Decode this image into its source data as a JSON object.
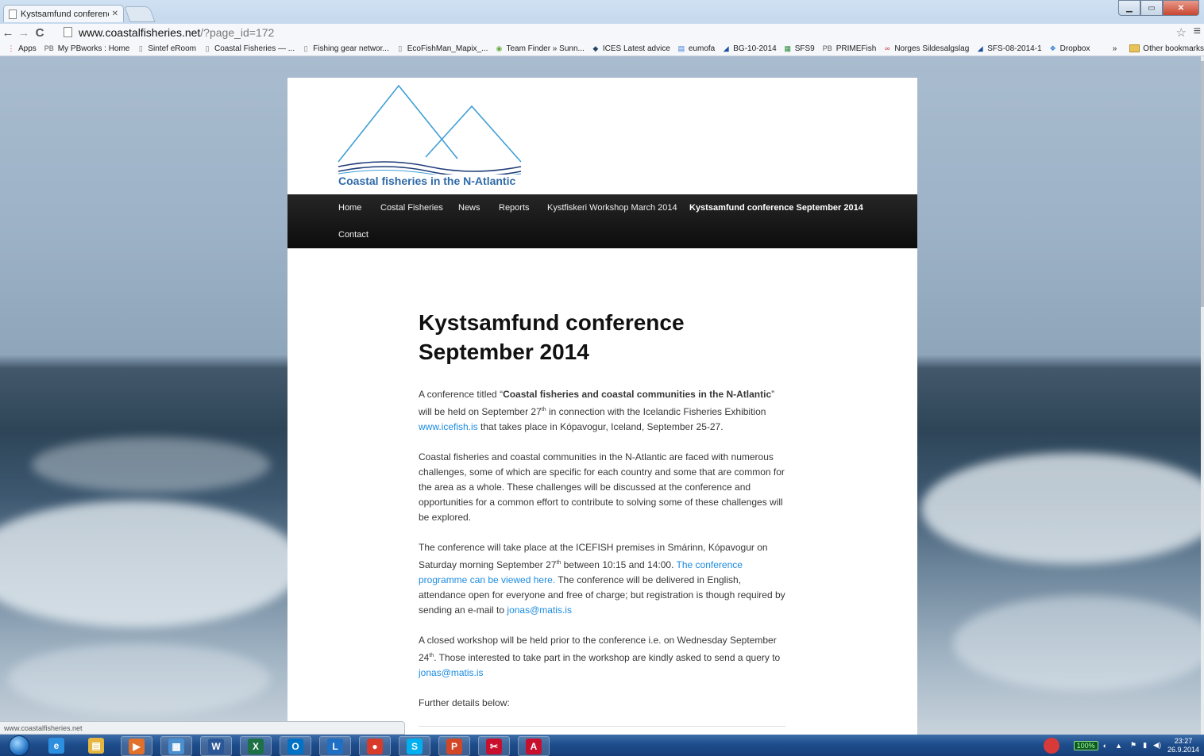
{
  "browser": {
    "tab_title": "Kystsamfund conference –",
    "url_host": "www.coastalfisheries.net",
    "url_path": "/?page_id=172",
    "bookmarks": [
      {
        "icon": "apps-grid-icon",
        "label": "Apps"
      },
      {
        "icon": "pbworks-icon",
        "label": "My PBworks : Home"
      },
      {
        "icon": "page-icon",
        "label": "Sintef eRoom"
      },
      {
        "icon": "page-icon",
        "label": "Coastal Fisheries — ..."
      },
      {
        "icon": "page-icon",
        "label": "Fishing gear networ..."
      },
      {
        "icon": "page-icon",
        "label": "EcoFishMan_Mapix_..."
      },
      {
        "icon": "team-finder-icon",
        "label": "Team Finder » Sunn..."
      },
      {
        "icon": "ices-icon",
        "label": "ICES Latest advice"
      },
      {
        "icon": "eumofa-icon",
        "label": "eumofa"
      },
      {
        "icon": "chart-icon",
        "label": "BG-10-2014"
      },
      {
        "icon": "sheet-icon",
        "label": "SFS9"
      },
      {
        "icon": "pbworks-icon",
        "label": "PRIMEFish"
      },
      {
        "icon": "sildesalgslag-icon",
        "label": "Norges Sildesalgslag"
      },
      {
        "icon": "chart-icon",
        "label": "SFS-08-2014-1"
      },
      {
        "icon": "dropbox-icon",
        "label": "Dropbox"
      }
    ],
    "more_bookmarks": "»",
    "other_bookmarks": "Other bookmarks",
    "status_url": "www.coastalfisheries.net"
  },
  "site": {
    "brand": "Coastal fisheries in the N-Atlantic",
    "nav": [
      "Home",
      "Costal Fisheries",
      "News",
      "Reports",
      "Kystfiskeri Workshop March 2014",
      "Kystsamfund conference September 2014",
      "Contact"
    ],
    "current_nav_index": 5
  },
  "article": {
    "title_line1": "Kystsamfund conference",
    "title_line2": "September 2014",
    "p1": {
      "lead": "A conference titled “",
      "bold": "Coastal fisheries and coastal communities in the N-Atlantic",
      "after_bold": "”",
      "line2_pre": "will be held on September 27",
      "sup": "th",
      "line2_post": " in connection with the Icelandic Fisheries Exhibition",
      "link": "www.icefish.is",
      "tail": " that takes place in Kópavogur, Iceland, September 25-27."
    },
    "p2": "Coastal fisheries and coastal communities in the N-Atlantic are faced with numerous challenges, some of which are specific for each country and some that are common for the area as a whole. These challenges will be discussed at the conference and opportunities for a common effort to contribute to solving some of these challenges will be explored.",
    "p3": {
      "line1": "The conference will take place at the ICEFISH premises in Smárinn, Kópavogur on",
      "line2_pre": "Saturday morning September 27",
      "sup": "th",
      "line2_post": " between 10:15 and 14:00. ",
      "link": "The conference programme can be viewed here.",
      "tail": " The conference will be delivered in English, attendance open for everyone and free of charge; but registration is though required by sending an e-mail to ",
      "email": "jonas@matis.is"
    },
    "p4": {
      "pre": "A closed workshop will be held prior to the conference i.e. on Wednesday September 24",
      "sup": "th",
      "post": ". Those interested to take part in the workshop are kindly asked to send a query to",
      "email": "jonas@matis.is"
    },
    "p5": "Further details below:"
  },
  "taskbar": {
    "apps": [
      {
        "name": "internet-explorer",
        "glyph": "e"
      },
      {
        "name": "file-explorer",
        "glyph": "▤"
      },
      {
        "name": "media-player",
        "glyph": "▶"
      },
      {
        "name": "paint-app",
        "glyph": "▦"
      },
      {
        "name": "word",
        "glyph": "W"
      },
      {
        "name": "excel",
        "glyph": "X"
      },
      {
        "name": "outlook",
        "glyph": "O"
      },
      {
        "name": "lync",
        "glyph": "L"
      },
      {
        "name": "chrome",
        "glyph": "●"
      },
      {
        "name": "skype",
        "glyph": "S"
      },
      {
        "name": "powerpoint",
        "glyph": "P"
      },
      {
        "name": "snipping-tool",
        "glyph": "✂"
      },
      {
        "name": "acrobat",
        "glyph": "A"
      }
    ],
    "battery": "100%",
    "time": "23:27",
    "date": "26.9.2014"
  },
  "colors": {
    "link": "#1b8be0",
    "brand_blue": "#2f6aa8",
    "nav_bg": "#0c0c0c"
  }
}
